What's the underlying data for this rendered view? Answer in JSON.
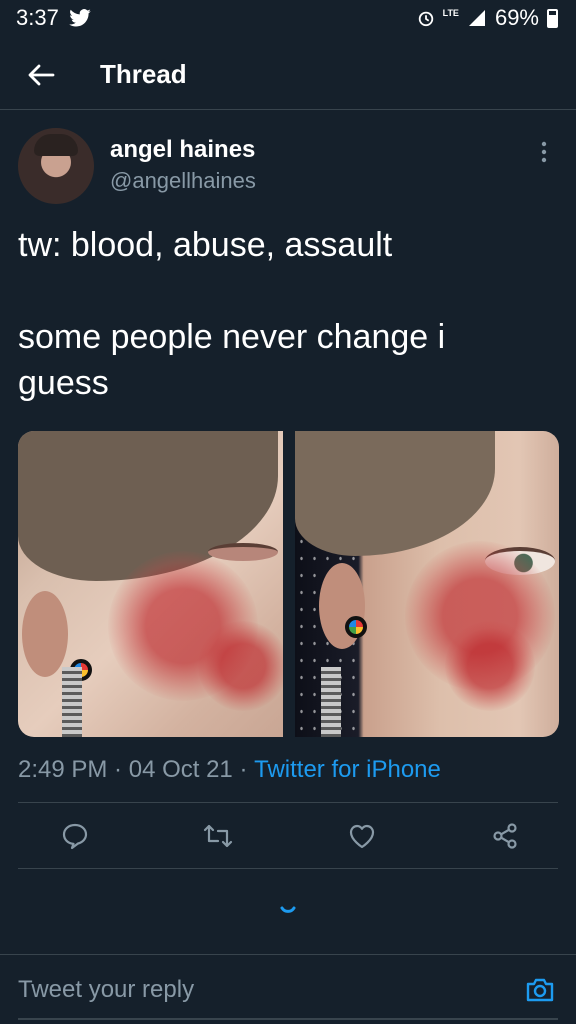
{
  "status_bar": {
    "time": "3:37",
    "network": "LTE",
    "battery": "69%"
  },
  "header": {
    "title": "Thread"
  },
  "tweet": {
    "author": {
      "display_name": "angel haines",
      "handle": "@angellhaines"
    },
    "text": "tw: blood, abuse, assault\n\nsome people never change i\nguess",
    "time": "2:49 PM",
    "date": "04 Oct 21",
    "source": "Twitter for iPhone"
  },
  "reply": {
    "placeholder": "Tweet your reply"
  },
  "colors": {
    "background": "#15202b",
    "accent": "#1d9bf0",
    "muted": "#8899a6",
    "divider": "#38444d"
  }
}
